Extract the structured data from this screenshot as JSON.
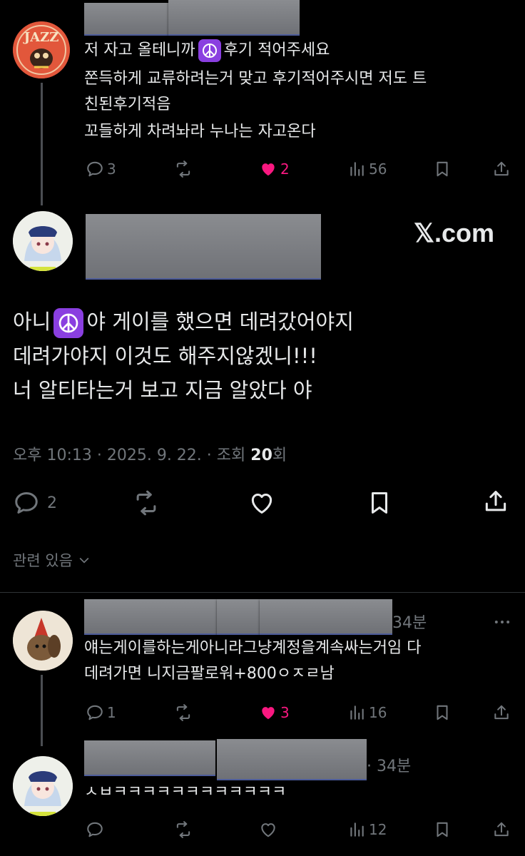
{
  "reply1": {
    "lines": [
      "저 자고 올테니까",
      "후기 적어주세요",
      "쫀득하게 교류하려는거 맞고 후기적어주시면 저도 트",
      "친된후기적음",
      "꼬들하게 차려놔라 누나는 자고온다"
    ],
    "reply_count": "3",
    "like_count": "2",
    "view_count": "56",
    "avatar_text": "JAZZ"
  },
  "main": {
    "watermark": "𝕏.com",
    "line1_a": "아니",
    "line1_b": "야 게이를 했으면 데려갔어야지",
    "line2": "데려가야지 이것도 해주지않겠니!!!",
    "line3": "너 알티타는거 보고 지금 알았다 야",
    "meta_prefix": "오후 10:13 · 2025. 9. 22. · 조회 ",
    "meta_views": "20",
    "meta_suffix": "회",
    "reply_count": "2"
  },
  "related_label": "관련 있음",
  "reply2": {
    "time": "34분",
    "line1": "얘는게이를하는게아니라그냥계정을계속싸는거임 다",
    "line2": "데려가면 니지금팔로워+800ㅇㅈㄹ남",
    "reply_count": "1",
    "like_count": "3",
    "view_count": "16"
  },
  "reply3": {
    "time": "· 34분",
    "line1": "ㅅㅂㅋㅋㅋㅋㅋㅋㅋㅋㅋㅋㅋㅋ",
    "view_count": "12"
  },
  "colors": {
    "like_active": "#f91880",
    "muted": "#71767b",
    "peace_bg": "#8a3fe0"
  }
}
